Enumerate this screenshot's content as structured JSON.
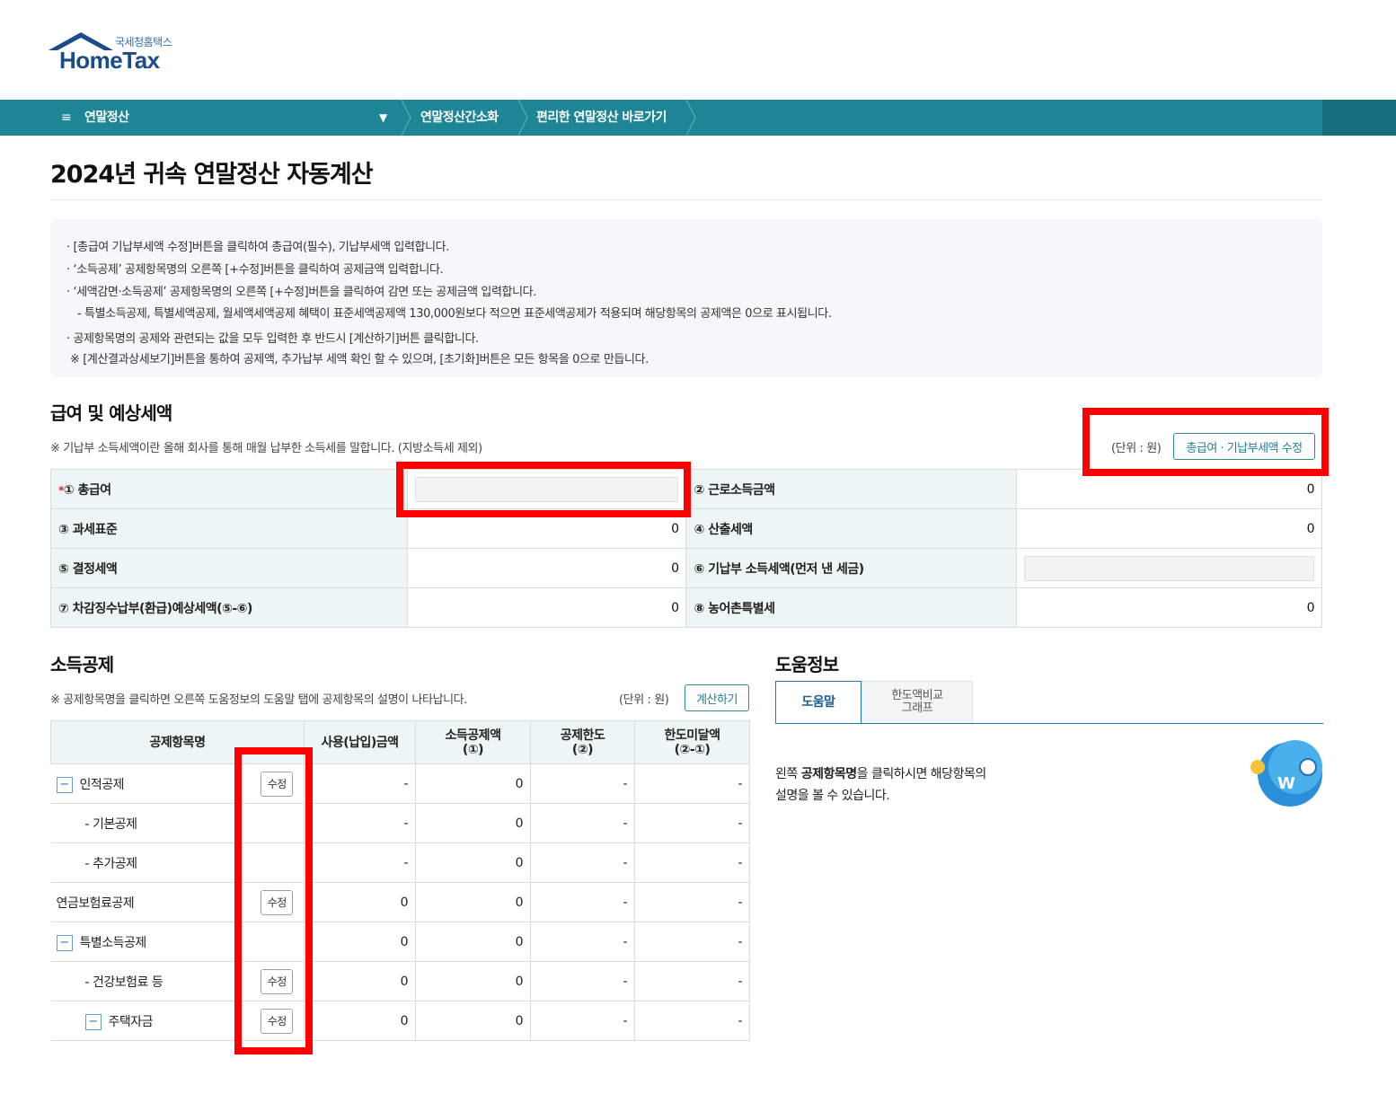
{
  "logo": {
    "small": "국세청홈택스",
    "big": "HomeTax"
  },
  "nav": {
    "menu_label": "연말정산",
    "items": [
      "연말정산간소화",
      "편리한 연말정산 바로가기"
    ]
  },
  "page_title": "2024년 귀속 연말정산 자동계산",
  "guide": [
    "[총급여 기납부세액 수정]버튼을 클릭하여 총급여(필수), 기납부세액 입력합니다.",
    "‘소득공제’ 공제항목명의 오른쪽 [+수정]버튼을 클릭하여 공제금액 입력합니다.",
    "‘세액감면·소득공제’ 공제항목명의 오른쪽 [+수정]버튼을 클릭하여 감면 또는 공제금액 입력합니다.",
    "- 특별소득공제, 특별세액공제, 월세액세액공제 혜택이 표준세액공제액 130,000원보다 적으면 표준세액공제가 적용되며 해당항목의 공제액은 0으로 표시됩니다.",
    "공제항목명의 공제와 관련되는 값을 모두 입력한 후 반드시 [계산하기]버튼 클릭합니다.",
    "※ [계산결과상세보기]버튼을 통하여 공제액, 추가납부 세액 확인 할 수 있으며, [초기화]버튼은 모든 항목을 0으로 만듭니다."
  ],
  "salary": {
    "heading": "급여 및 예상세액",
    "note": "※ 기납부 소득세액이란 올해 회사를 통해 매월 납부한 소득세를 말합니다. (지방소득세 제외)",
    "unit": "(단위 : 원)",
    "edit_button": "총급여 · 기납부세액 수정",
    "required_mark": "*",
    "rows": [
      {
        "l1": "① 총급여",
        "v1": "",
        "l2": "② 근로소득금액",
        "v2": "0"
      },
      {
        "l1": "③ 과세표준",
        "v1": "0",
        "l2": "④ 산출세액",
        "v2": "0"
      },
      {
        "l1": "⑤ 결정세액",
        "v1": "0",
        "l2": "⑥ 기납부 소득세액(먼저 낸 세금)",
        "v2": ""
      },
      {
        "l1": "⑦ 차감징수납부(환급)예상세액(⑤-⑥)",
        "v1": "0",
        "l2": "⑧ 농어촌특별세",
        "v2": "0"
      }
    ]
  },
  "deduction": {
    "heading": "소득공제",
    "note": "※ 공제항목명을 클릭하면 오른쪽 도움정보의 도움말 탭에 공제항목의 설명이 나타납니다.",
    "unit": "(단위 : 원)",
    "calc_button": "계산하기",
    "headers": [
      "공제항목명",
      "사용(납입)금액",
      "소득공제액\n(①)",
      "공제한도\n(②)",
      "한도미달액\n(②-①)"
    ],
    "edit_label": "수정",
    "toggle_symbol": "−",
    "rows": [
      {
        "name": "인적공제",
        "toggle": true,
        "indent": 0,
        "edit": true,
        "used": "-",
        "amount": "0",
        "limit": "-",
        "short": "-"
      },
      {
        "name": "- 기본공제",
        "toggle": false,
        "indent": 1,
        "edit": false,
        "used": "-",
        "amount": "0",
        "limit": "-",
        "short": "-"
      },
      {
        "name": "- 추가공제",
        "toggle": false,
        "indent": 1,
        "edit": false,
        "used": "-",
        "amount": "0",
        "limit": "-",
        "short": "-"
      },
      {
        "name": "연금보험료공제",
        "toggle": false,
        "indent": 0,
        "edit": true,
        "used": "0",
        "amount": "0",
        "limit": "-",
        "short": "-"
      },
      {
        "name": "특별소득공제",
        "toggle": true,
        "indent": 0,
        "edit": false,
        "used": "0",
        "amount": "0",
        "limit": "-",
        "short": "-"
      },
      {
        "name": "- 건강보험료 등",
        "toggle": false,
        "indent": 1,
        "edit": true,
        "used": "0",
        "amount": "0",
        "limit": "-",
        "short": "-"
      },
      {
        "name": "주택자금",
        "toggle": true,
        "indent": 2,
        "edit": true,
        "used": "0",
        "amount": "0",
        "limit": "-",
        "short": "-"
      }
    ]
  },
  "help": {
    "heading": "도움정보",
    "tab_active": "도움말",
    "tab_inactive": "한도액비교\n그래프",
    "text_bold": "공제항목명",
    "text_before": "왼쪽 ",
    "text_after": "을 클릭하시면 해당항목의",
    "text_line2": "설명을 볼 수 있습니다.",
    "mascot_letter": "W"
  },
  "colors": {
    "nav": "#1d8596",
    "highlight": "#ff0000",
    "accent": "#1d7f95"
  }
}
